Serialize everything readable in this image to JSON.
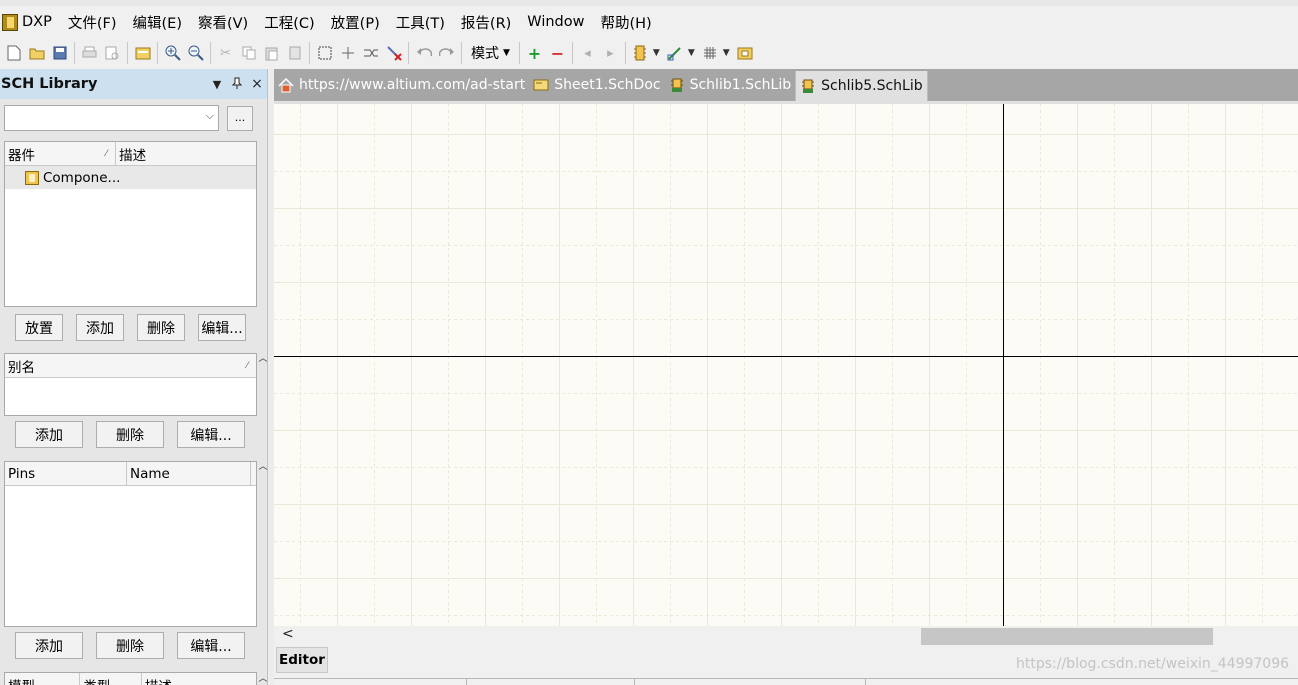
{
  "menubar": {
    "items": [
      "DXP",
      "文件(F)",
      "编辑(E)",
      "察看(V)",
      "工程(C)",
      "放置(P)",
      "工具(T)",
      "报告(R)",
      "Window",
      "帮助(H)"
    ]
  },
  "toolbar": {
    "mode_label": "模式"
  },
  "panel": {
    "title": "SCH Library",
    "combo_value": "",
    "dots_label": "...",
    "components": {
      "headers": [
        "器件",
        "描述"
      ],
      "rows": [
        {
          "name": "Compone...",
          "description": ""
        }
      ]
    },
    "component_buttons": [
      "放置",
      "添加",
      "删除",
      "编辑..."
    ],
    "aliases": {
      "headers": [
        "别名"
      ],
      "rows": []
    },
    "alias_buttons": [
      "添加",
      "删除",
      "编辑..."
    ],
    "pins": {
      "headers": [
        "Pins",
        "Name"
      ],
      "rows": []
    },
    "pin_buttons": [
      "添加",
      "删除",
      "编辑..."
    ],
    "models": {
      "headers": [
        "模型",
        "类型",
        "描述"
      ]
    }
  },
  "tabs": [
    {
      "label": "https://www.altium.com/ad-start",
      "icon": "home-icon",
      "active": false
    },
    {
      "label": "Sheet1.SchDoc",
      "icon": "sheet-icon",
      "active": false
    },
    {
      "label": "Schlib1.SchLib",
      "icon": "schlib-icon",
      "active": false
    },
    {
      "label": "Schlib5.SchLib",
      "icon": "schlib-icon",
      "active": true
    }
  ],
  "editor_tab": "Editor",
  "watermark": "https://blog.csdn.net/weixin_44997096",
  "colors": {
    "panel_header": "#cde0ef",
    "tabbar": "#a6a6a6",
    "canvas_bg": "#fdfbf5",
    "grid_line": "#ede7da",
    "crosshair": "#000000"
  }
}
